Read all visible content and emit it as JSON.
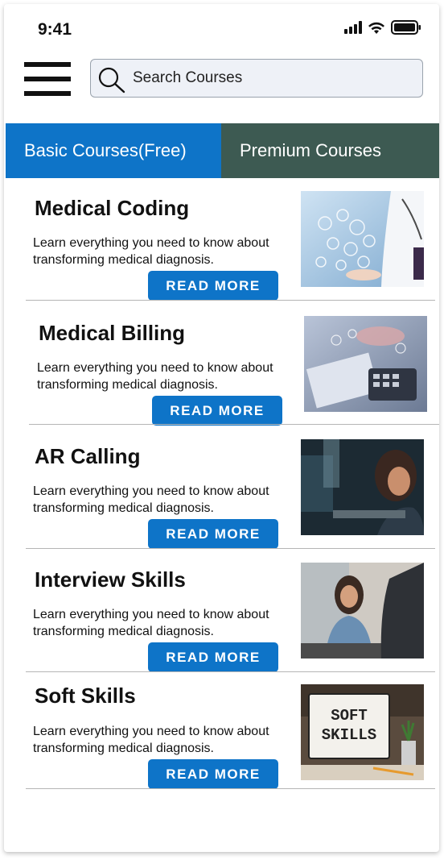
{
  "status_bar": {
    "time": "9:41"
  },
  "search": {
    "placeholder": "Search Courses"
  },
  "tabs": [
    {
      "label": "Basic Courses(Free)"
    },
    {
      "label": "Premium Courses"
    }
  ],
  "courses": [
    {
      "title": "Medical Coding",
      "description": "Learn everything  you need to know about transforming medical diagnosis.",
      "button": "READ MORE"
    },
    {
      "title": "Medical Billing",
      "description": "Learn everything  you need to know about transforming medical diagnosis.",
      "button": "READ MORE"
    },
    {
      "title": "AR Calling",
      "description": "Learn everything  you need to know about transforming medical diagnosis.",
      "button": "READ MORE"
    },
    {
      "title": "Interview Skills",
      "description": "Learn everything  you need to know about transforming medical diagnosis.",
      "button": "READ MORE"
    },
    {
      "title": "Soft Skills",
      "description": "Learn everything  you need to know about transforming medical diagnosis.",
      "button": "READ MORE",
      "image_text": [
        "SOFT",
        "SKILLS"
      ]
    }
  ],
  "colors": {
    "primary_blue": "#0e74c8",
    "premium_tab": "#3d5a52"
  }
}
